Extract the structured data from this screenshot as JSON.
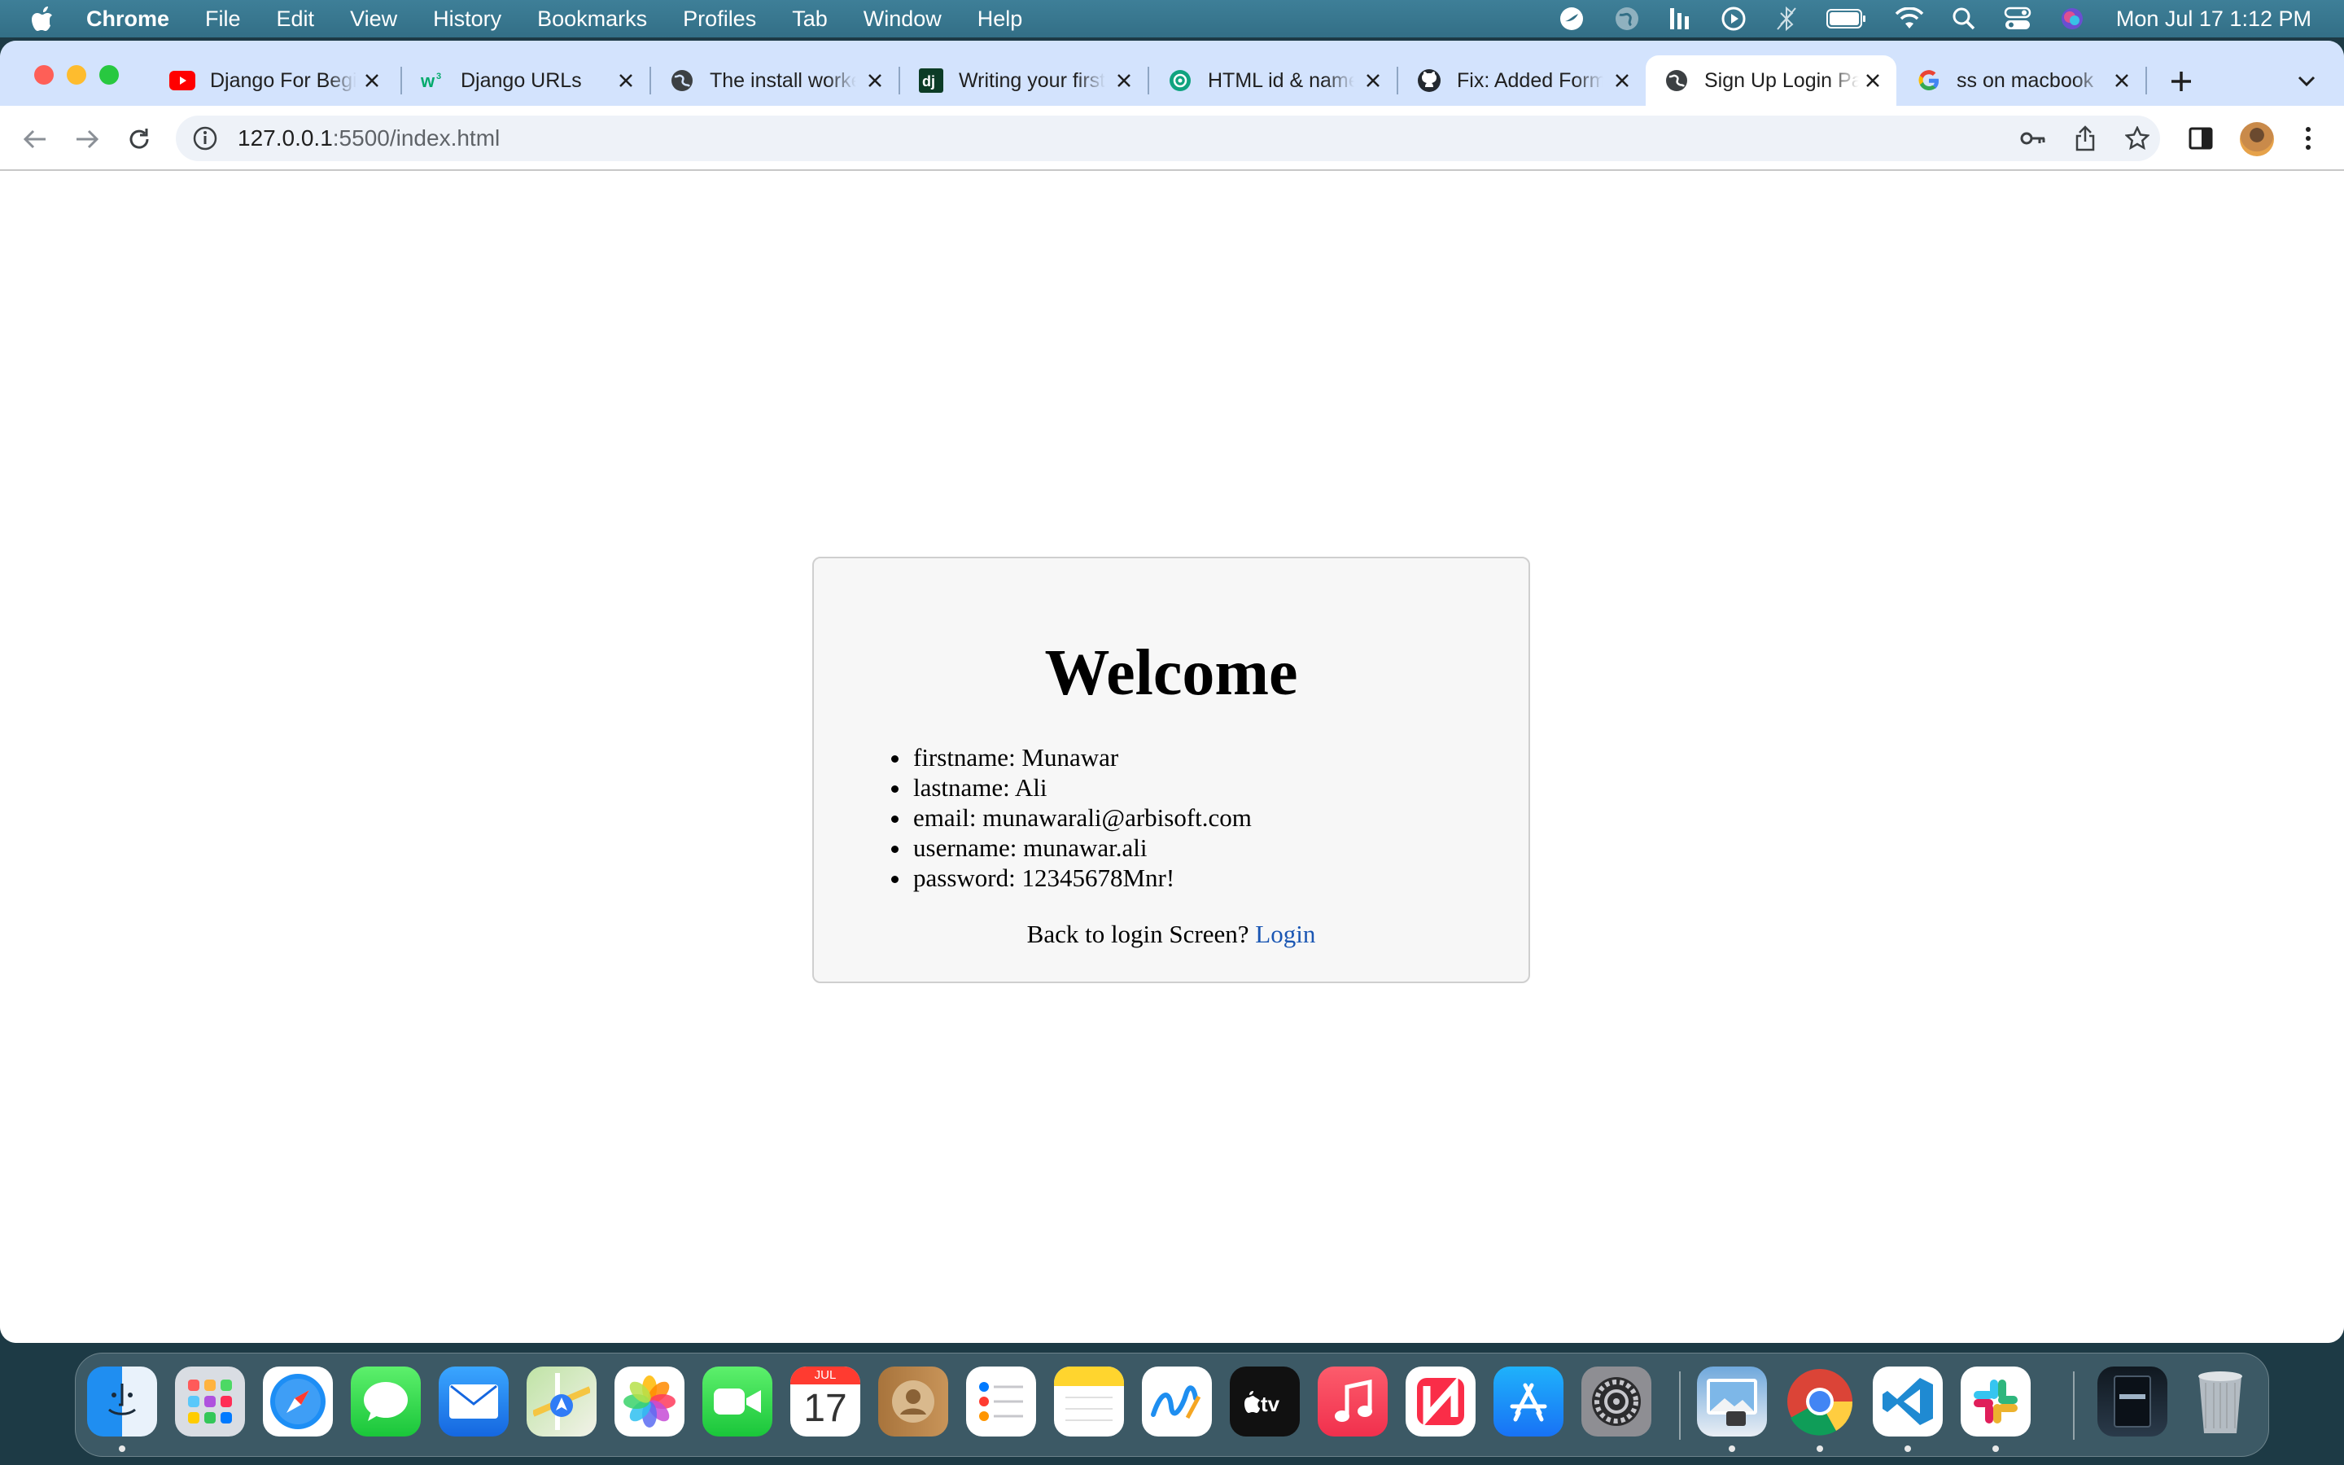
{
  "menubar": {
    "app": "Chrome",
    "items": [
      "File",
      "Edit",
      "View",
      "History",
      "Bookmarks",
      "Profiles",
      "Tab",
      "Window",
      "Help"
    ],
    "clock": "Mon Jul 17  1:12 PM"
  },
  "tabs": [
    {
      "title": "Django For Beginners",
      "icon": "youtube-icon"
    },
    {
      "title": "Django URLs",
      "icon": "w3schools-icon"
    },
    {
      "title": "The install worked",
      "icon": "globe-icon"
    },
    {
      "title": "Writing your first Django app",
      "icon": "django-icon"
    },
    {
      "title": "HTML id & name",
      "icon": "chatgpt-icon"
    },
    {
      "title": "Fix: Added Form",
      "icon": "github-icon"
    },
    {
      "title": "Sign Up Login Page",
      "icon": "globe-icon",
      "active": true
    },
    {
      "title": "ss on macbook",
      "icon": "google-icon"
    }
  ],
  "address": {
    "host": "127.0.0.1",
    "rest": ":5500/index.html"
  },
  "welcome": {
    "title": "Welcome",
    "fields": [
      "firstname: Munawar",
      "lastname: Ali",
      "email: munawarali@arbisoft.com",
      "username: munawar.ali",
      "password: 12345678Mnr!"
    ],
    "back_text": "Back to login Screen? ",
    "login_link": "Login"
  },
  "dock": {
    "calendar_month": "JUL",
    "calendar_day": "17"
  },
  "colors": {
    "menubar": "#3e7f98",
    "tabbar": "#d3e3fd",
    "link": "#1a56b3"
  }
}
